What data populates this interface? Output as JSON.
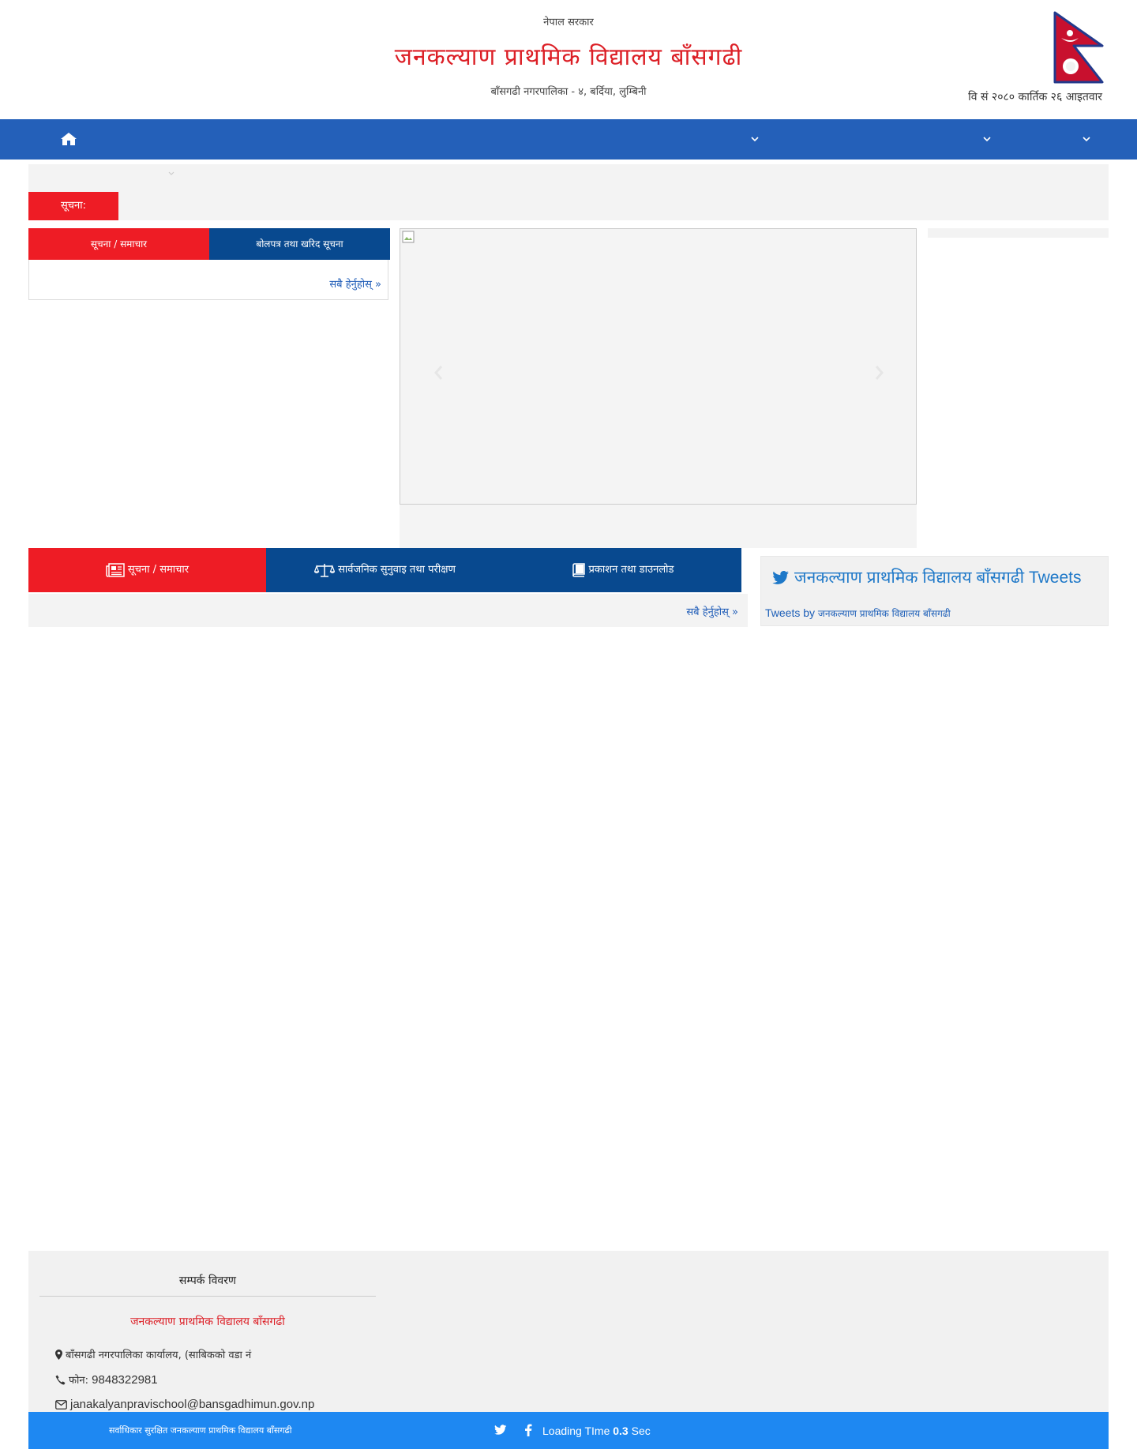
{
  "header": {
    "government": "नेपाल सरकार",
    "title": "जनकल्याण प्राथमिक विद्यालय बाँसगढी",
    "subtitle": "बाँसगढी नगरपालिका - ४, बर्दिया, लुम्बिनी",
    "date": "वि सं २०८० कार्तिक २६ आइतवार"
  },
  "nav": {
    "home_icon": "home-icon",
    "caret_icon": "chevron-down-icon"
  },
  "ticker": {
    "label": "सूचना:"
  },
  "left_tabs": {
    "tab1": "सूचना / समाचार",
    "tab2": "बोलपत्र तथा खरिद सूचना",
    "more": "सबै हेर्नुहोस् »"
  },
  "slider": {
    "prev_icon": "chevron-left-icon",
    "next_icon": "chevron-right-icon"
  },
  "notice_tabs": {
    "tab1": "सूचना / समाचार",
    "tab2": "सार्वजनिक सुनुवाइ तथा परीक्षण",
    "tab3": "प्रकाशन तथा डाउनलोड",
    "more": "सबै हेर्नुहोस् »"
  },
  "twitter": {
    "title": "जनकल्याण प्राथमिक विद्यालय बाँसगढी Tweets",
    "by_prefix": "Tweets by",
    "by_name": "जनकल्याण प्राथमिक विद्यालय बाँसगढी"
  },
  "footer": {
    "heading": "सम्पर्क विवरण",
    "name": "जनकल्याण प्राथमिक विद्यालय बाँसगढी",
    "address": "बाँसगढी नगरपालिका कार्यालय, (साबिकको वडा नं",
    "phone_label": "फोन:",
    "phone": "9848322981",
    "email": "janakalyanpravischool@bansgadhimun.gov.np",
    "copyright": "सर्वाधिकार सुरक्षित जनकल्याण प्राथमिक विद्यालय बाँसगढी",
    "loading_prefix": "Loading TIme",
    "loading_value": "0.3",
    "loading_suffix": "Sec"
  },
  "colors": {
    "nav_blue": "#2460b9",
    "tab_red": "#ee1c25",
    "tab_navy": "#08498f",
    "title_red": "#dc1f26",
    "footer_blue": "#1e88f2"
  }
}
